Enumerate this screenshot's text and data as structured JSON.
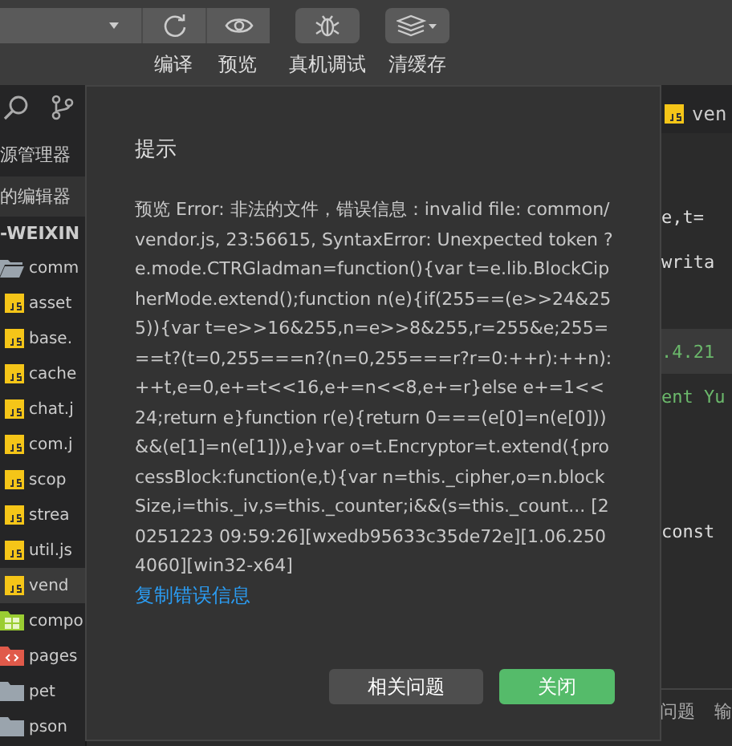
{
  "toolbar": {
    "buttons": [
      {
        "label": "编译"
      },
      {
        "label": "预览"
      },
      {
        "label": "真机调试"
      },
      {
        "label": "清缓存"
      }
    ]
  },
  "sidebar": {
    "section_title": "源管理器",
    "open_editors": "的编辑器",
    "project": "-WEIXIN",
    "tree": [
      {
        "name": "comm",
        "kind": "folder",
        "expanded": true,
        "selected": false,
        "children": [
          {
            "name": "asset",
            "kind": "js",
            "selected": false
          },
          {
            "name": "base.",
            "kind": "js",
            "selected": false
          },
          {
            "name": "cache",
            "kind": "js",
            "selected": false
          },
          {
            "name": "chat.j",
            "kind": "js",
            "selected": false
          },
          {
            "name": "com.j",
            "kind": "js",
            "selected": false
          },
          {
            "name": "scop",
            "kind": "js",
            "selected": false
          },
          {
            "name": "strea",
            "kind": "js",
            "selected": false
          },
          {
            "name": "util.js",
            "kind": "js",
            "selected": false
          },
          {
            "name": "vend",
            "kind": "js",
            "selected": true
          }
        ]
      },
      {
        "name": "compo",
        "kind": "components",
        "selected": false
      },
      {
        "name": "pages",
        "kind": "pages",
        "selected": false
      },
      {
        "name": "pet",
        "kind": "folder",
        "selected": false
      },
      {
        "name": "pson",
        "kind": "folder",
        "selected": false
      }
    ]
  },
  "editor": {
    "tab": "ven",
    "code_lines": [
      {
        "kind": "blank"
      },
      {
        "text": "e,t=",
        "kind": "plain"
      },
      {
        "text": "writa",
        "kind": "plain"
      },
      {
        "kind": "blank"
      },
      {
        "text": ".4.21",
        "kind": "highlight"
      },
      {
        "text": "ent Yu",
        "kind": "comment"
      },
      {
        "kind": "blank"
      },
      {
        "kind": "blank"
      },
      {
        "text": "const",
        "kind": "plain"
      }
    ],
    "panel_tabs": [
      "问题",
      "输"
    ]
  },
  "dialog": {
    "title": "提示",
    "message": "预览 Error: 非法的文件，错误信息：invalid file: common/vendor.js, 23:56615, SyntaxError: Unexpected token ? e.mode.CTRGladman=function(){var t=e.lib.BlockCipherMode.extend();function n(e){if(255==(e>>24&255)){var t=e>>16&255,n=e>>8&255,r=255&e;255===t?(t=0,255===n?(n=0,255===r?r=0:++r):++n):++t,e=0,e+=t<<16,e+=n<<8,e+=r}else e+=1<<24;return e}function r(e){return 0===(e[0]=n(e[0]))&&(e[1]=n(e[1])),e}var o=t.Encryptor=t.extend({processBlock:function(e,t){var n=this._cipher,o=n.blockSize,i=this._iv,s=this._counter;i&&(s=this._count... [20251223 09:59:26][wxedb95633c35de72e][1.06.2504060][win32-x64]",
    "link": "复制错误信息",
    "buttons": [
      {
        "label": "相关问题",
        "kind": "secondary"
      },
      {
        "label": "关闭",
        "kind": "primary"
      }
    ]
  }
}
